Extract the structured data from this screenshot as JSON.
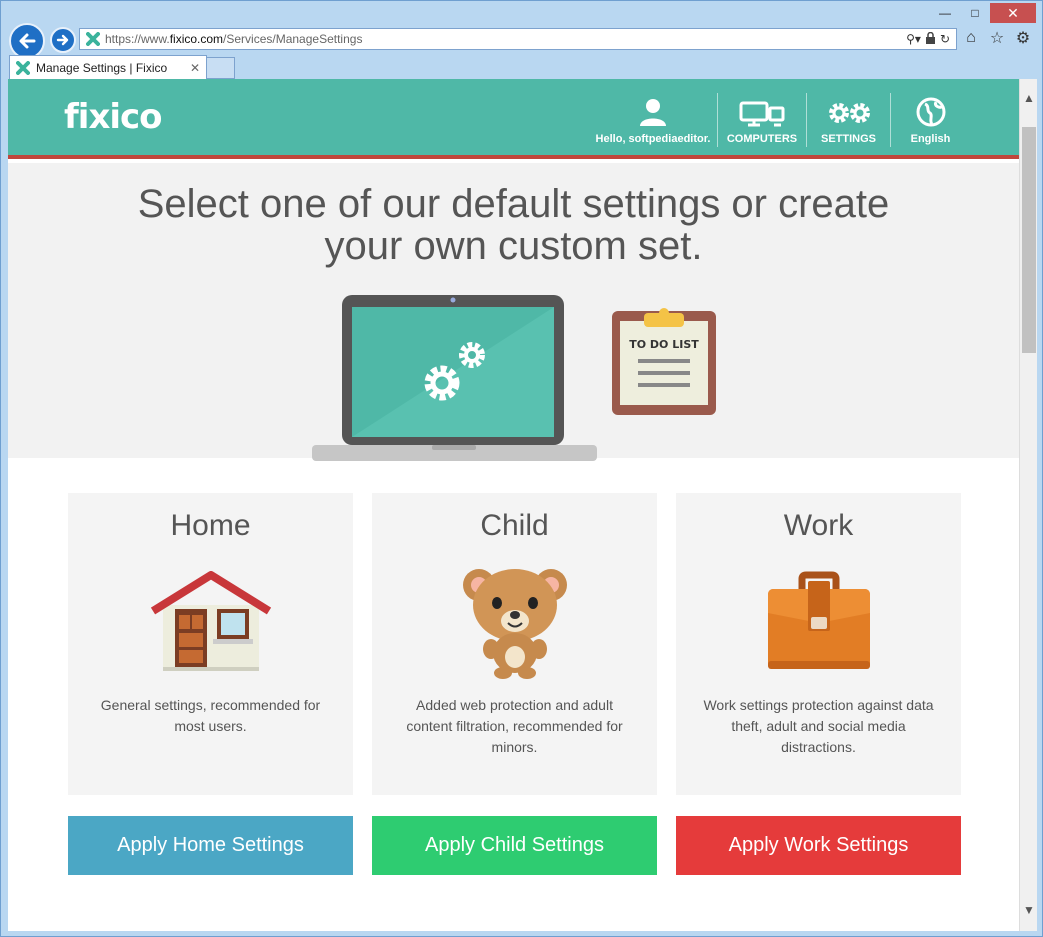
{
  "browser": {
    "window_controls": {
      "minimize": "—",
      "maximize": "□",
      "close": "✕"
    },
    "address": {
      "scheme": "https://www.",
      "domain": "fixico.com",
      "path": "/Services/ManageSettings"
    },
    "tab": {
      "title": "Manage Settings | Fixico",
      "close": "✕"
    },
    "scrollbar": {
      "up": "▲",
      "down": "▼"
    },
    "icons": {
      "search": "⚲▾",
      "lock": "🔒",
      "refresh": "↻",
      "home": "⌂",
      "favorites": "☆",
      "tools": "⚙"
    }
  },
  "site": {
    "logo": "fixico",
    "nav": [
      {
        "label": "Hello, softpediaeditor.",
        "icon": "user-icon"
      },
      {
        "label": "COMPUTERS",
        "icon": "computers-icon"
      },
      {
        "label": "SETTINGS",
        "icon": "gears-icon"
      },
      {
        "label": "English",
        "icon": "globe-icon"
      }
    ],
    "accent": "#4fb8a7",
    "stripe": "#c0463c"
  },
  "hero": {
    "title_line1": "Select one of our default settings or create",
    "title_line2": "your own custom set.",
    "todo_label": "TO DO LIST"
  },
  "cards": [
    {
      "title": "Home",
      "description": "General settings, recommended for most users.",
      "icon": "house-icon"
    },
    {
      "title": "Child",
      "description": "Added web protection and adult content filtration, recommended for minors.",
      "icon": "teddy-bear-icon"
    },
    {
      "title": "Work",
      "description": "Work settings protection against data theft, adult and social media distractions.",
      "icon": "briefcase-icon"
    }
  ],
  "buttons": {
    "home": {
      "label": "Apply Home Settings",
      "color": "#4ba7c5"
    },
    "child": {
      "label": "Apply Child Settings",
      "color": "#2ecc71"
    },
    "work": {
      "label": "Apply Work Settings",
      "color": "#e53b3b"
    }
  }
}
